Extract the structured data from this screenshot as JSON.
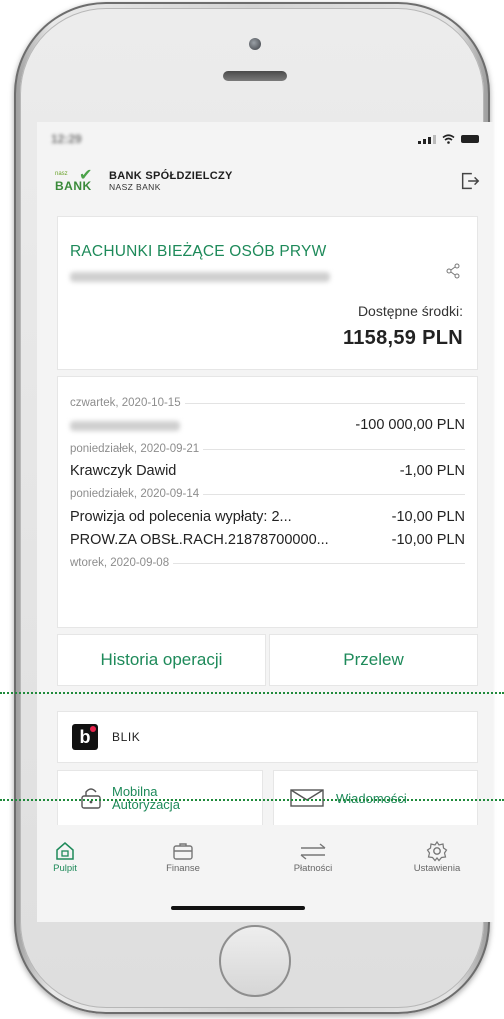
{
  "status_bar": {
    "time": "12:29"
  },
  "header": {
    "brand_small": "nasz",
    "brand_logo": "BANK",
    "bank_name": "BANK SPÓŁDZIELCZY",
    "bank_sub": "NASZ BANK",
    "logout_icon": "logout-icon"
  },
  "account": {
    "title": "RACHUNKI BIEŻĄCE OSÓB PRYW",
    "available_label": "Dostępne środki:",
    "available_amount": "1158,59 PLN"
  },
  "history": {
    "dates": [
      "czwartek, 2020-10-15",
      "poniedziałek, 2020-09-21",
      "poniedziałek, 2020-09-14",
      "wtorek, 2020-09-08"
    ],
    "transactions": [
      {
        "name": "",
        "amount": "-100 000,00 PLN"
      },
      {
        "name": "Krawczyk Dawid",
        "amount": "-1,00 PLN"
      },
      {
        "name": "Prowizja od polecenia wypłaty: 2...",
        "amount": "-10,00 PLN"
      },
      {
        "name": "PROW.ZA OBSŁ.RACH.21878700000...",
        "amount": "-10,00 PLN"
      }
    ]
  },
  "actions": {
    "history_button": "Historia operacji",
    "transfer_button": "Przelew"
  },
  "blik": {
    "label": "BLIK"
  },
  "tiles": {
    "mobile_auth_line1": "Mobilna",
    "mobile_auth_line2": "Autoryzacja",
    "messages": "Wiadomości"
  },
  "nav": [
    {
      "label": "Pulpit",
      "icon": "home-icon"
    },
    {
      "label": "Finanse",
      "icon": "wallet-icon"
    },
    {
      "label": "Płatności",
      "icon": "transfer-arrows-icon"
    },
    {
      "label": "Ustawienia",
      "icon": "gear-icon"
    }
  ],
  "colors": {
    "accent": "#1e8a5a",
    "highlight_line": "#1f8a3b"
  }
}
